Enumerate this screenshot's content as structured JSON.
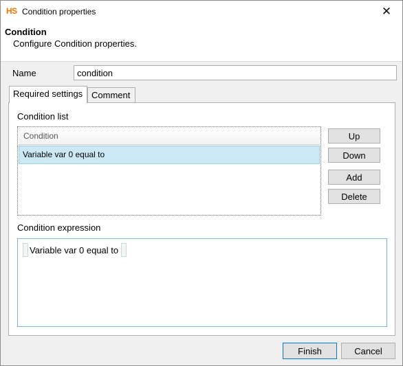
{
  "window": {
    "app_logo": "HS",
    "title": "Condition properties",
    "close_glyph": "✕"
  },
  "header": {
    "title": "Condition",
    "description": "Configure Condition properties."
  },
  "name_field": {
    "label": "Name",
    "value": "condition"
  },
  "tabs": [
    {
      "label": "Required settings",
      "active": true
    },
    {
      "label": "Comment",
      "active": false
    }
  ],
  "condition_list": {
    "label": "Condition list",
    "column_header": "Condition",
    "rows": [
      {
        "text": "Variable var  0 equal to",
        "selected": true
      }
    ]
  },
  "list_buttons": {
    "up": "Up",
    "down": "Down",
    "add": "Add",
    "delete": "Delete"
  },
  "condition_expression": {
    "label": "Condition expression",
    "text": "Variable var  0 equal to"
  },
  "footer": {
    "finish": "Finish",
    "cancel": "Cancel"
  },
  "colors": {
    "logo": "#f07800",
    "selection_bg": "#cce8f4",
    "focus_border": "#0078d7"
  }
}
